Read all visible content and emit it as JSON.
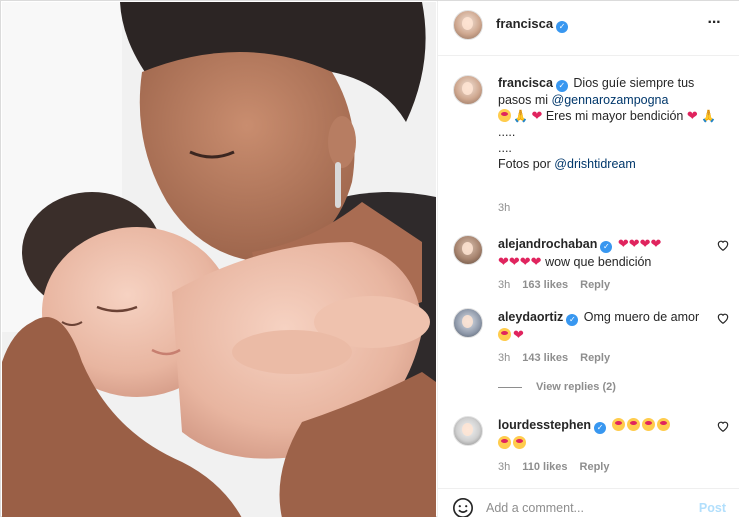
{
  "post": {
    "username": "francisca",
    "more_icon": "more-horizontal-icon",
    "photo_desc_icon": "post-photo"
  },
  "caption": {
    "username": "francisca",
    "text_part1": "Dios guíe siempre tus pasos mi",
    "mention1": "@gennarozampogna",
    "text_part2": "Eres mi mayor bendición",
    "dots1": ".....",
    "dots2": "....",
    "fotos_prefix": "Fotos por",
    "mention2": "@drishtidream",
    "time": "3h"
  },
  "comments": [
    {
      "username": "alejandrochaban",
      "hearts_prefix": "❤❤❤❤",
      "hearts_line2": "❤❤❤❤",
      "text": "wow que bendición",
      "time": "3h",
      "likes": "163 likes",
      "reply": "Reply"
    },
    {
      "username": "aleydaortiz",
      "text": "Omg muero de amor",
      "time": "3h",
      "likes": "143 likes",
      "reply": "Reply"
    },
    {
      "username": "lourdesstephen",
      "time": "3h",
      "likes": "110 likes",
      "reply": "Reply"
    }
  ],
  "view_replies": "View replies (2)",
  "add_comment": {
    "placeholder": "Add a comment...",
    "post_label": "Post"
  },
  "colors": {
    "verified": "#3897f0",
    "link": "#00376b",
    "muted": "#8e8e8e",
    "post_disabled": "#b2dffc",
    "heart": "#e0245e"
  }
}
